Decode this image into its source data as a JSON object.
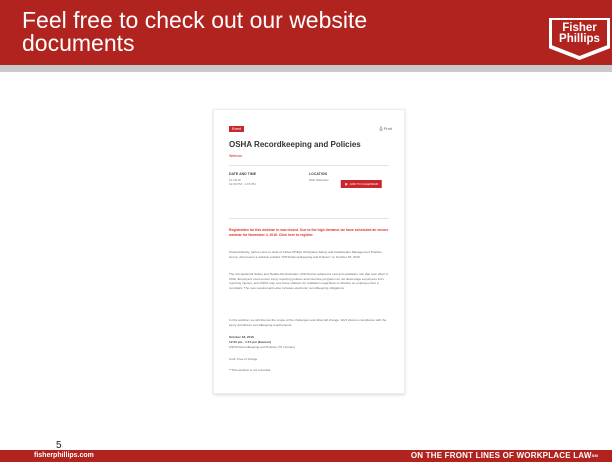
{
  "slide": {
    "title": "Feel free to check out our website documents",
    "number": "5"
  },
  "logo": {
    "line1": "Fisher",
    "line2": "Phillips"
  },
  "footer": {
    "url": "fisherphillips.com",
    "tagline": "ON THE FRONT LINES OF WORKPLACE LAW",
    "tagline_mark": "SM"
  },
  "document": {
    "tag": "Event",
    "top_right": "Print",
    "title": "OSHA Recordkeeping and Policies",
    "subtitle": "Webinar",
    "date_label": "DATE AND TIME",
    "date_value_1": "10.18.16",
    "date_value_2": "12:00 PM - 1:15 PM",
    "location_label": "LOCATION",
    "location_value": "Web Webinars",
    "add_to_calendar": "ADD TO CALENDAR",
    "notice": "Registration for this webinar is now closed. Due to the high demand, we have scheduled an encore webinar for November 4, 2016. Click here to register.",
    "para1": "Howard Mavity, partner and co-chair of Fisher Phillips Workplace Safety and Catastrophe Management Practice Group, will present a webinar entitled \"OSHA Recordkeeping and Policies\" on October 18, 2016.",
    "para2": "The Occupational Safety and Health Administration (OSHA) has adopted a new anti-retaliation rule that took effect in 2016. Employers must ensure injury reporting policies and incentive programs do not discourage employees from reporting injuries, and OSHA may now issue citations for retaliation regardless of whether an employee files a complaint. The new requirements also increase electronic recordkeeping obligations.",
    "para3": "In this webinar, we will discuss the scope of the challenges and what will change. We'll discuss compliance with the injury and illness recordkeeping requirements.",
    "when_label": "October 18, 2016",
    "when_time": "12:00 pm - 1:15 pm (Eastern)",
    "when_topic": "OSHA Recordkeeping and Policies (75 minutes)",
    "cost": "Cost: Free of charge",
    "footnote": "**This webinar is not recorded."
  }
}
